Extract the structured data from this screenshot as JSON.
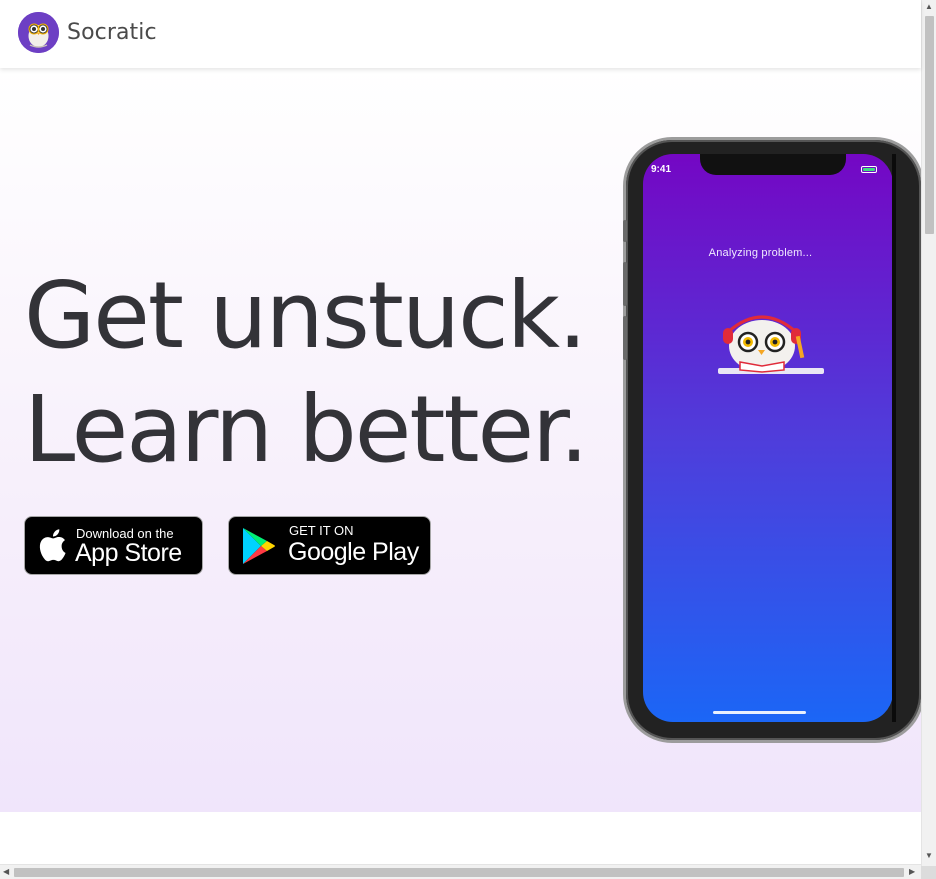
{
  "header": {
    "brand": "Socratic",
    "logo_icon": "owl-logo-icon"
  },
  "hero": {
    "headline_line1": "Get unstuck.",
    "headline_line2": "Learn better."
  },
  "buttons": {
    "app_store": {
      "small": "Download on the",
      "big": "App Store",
      "icon": "apple-icon"
    },
    "google_play": {
      "small": "GET IT ON",
      "big": "Google Play",
      "icon": "google-play-icon"
    }
  },
  "phone": {
    "status_time": "9:41",
    "status_text": "Analyzing problem...",
    "illustration": "owl-reading-icon"
  },
  "colors": {
    "brand_purple": "#6d3fc4",
    "screen_top": "#7407c4",
    "screen_bottom": "#1b66f6",
    "headline": "#333338"
  }
}
